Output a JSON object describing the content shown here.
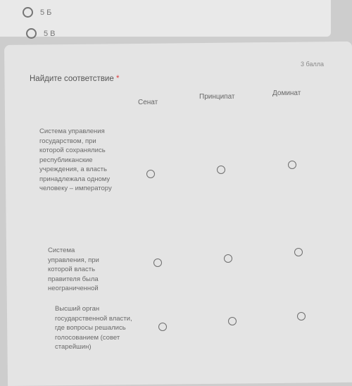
{
  "previous": {
    "options": [
      "5 Б",
      "5 В"
    ]
  },
  "question": {
    "title": "Найдите соответствие",
    "required_mark": "*",
    "points": "3 балла",
    "columns": [
      "Сенат",
      "Принципат",
      "Доминат"
    ],
    "rows": [
      "Система управления государством, при которой сохранялись республиканские учреждения, а власть принадлежала одному человеку – императору",
      "Система управления, при которой власть правителя была неограниченной",
      "Высший орган государственной власти, где вопросы решались голосованием (совет старейшин)"
    ]
  }
}
